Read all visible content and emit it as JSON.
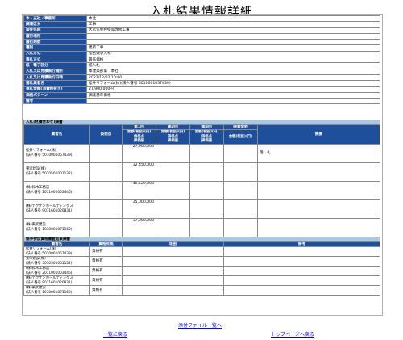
{
  "page_title": "入札結果情報詳細",
  "info_rows": [
    {
      "label": "本・支社／事務所",
      "value": "本社"
    },
    {
      "label": "調達区分",
      "value": "工事"
    },
    {
      "label": "案件名称",
      "value": "大宮信金共壁等改修工事"
    },
    {
      "label": "履行場所",
      "value": ""
    },
    {
      "label": "履行期間",
      "value": ""
    },
    {
      "label": "種別",
      "value": "建築工事"
    },
    {
      "label": "入札方式",
      "value": "指名競争入札"
    },
    {
      "label": "落札方式",
      "value": "最低価格"
    },
    {
      "label": "紙・電子区分",
      "value": "紙入札"
    },
    {
      "label": "入札又は見積執行場所",
      "value": "本建築部第　本社"
    },
    {
      "label": "入札又は見積執行日時",
      "value": "2022/12/02 10:00"
    },
    {
      "label": "落札業者名",
      "value": "松井リフォーム(株)(法人番号 5010001057439)"
    },
    {
      "label": "落札金額(消費税抜き)",
      "value": "27,900,000円"
    },
    {
      "label": "価格パターン",
      "value": "調達基準価格"
    },
    {
      "label": "備考",
      "value": ""
    }
  ],
  "bid_section": {
    "title": "入札(見積合わせ)調書",
    "headers": {
      "company": "業者名",
      "tech": "技術点",
      "round1": "第1回",
      "round2": "第2回",
      "round3": "第3回",
      "negotiation": "随意契約",
      "remarks": "摘要",
      "sub": "金額(税抜)(円)\n価格点\n評価値",
      "sub_neg": "金額(税抜)(円)"
    },
    "rows": [
      {
        "name": "松井リフォーム(株)",
        "corp": "(法人番号 5010001057439)",
        "amount": "27,900,000",
        "remark": "落　札"
      },
      {
        "name": "東栄建設(株)",
        "corp": "(法人番号 5010501001132)",
        "amount": "32,450,000",
        "remark": ""
      },
      {
        "name": "(株)鈴木工務店",
        "corp": "(法人番号 2011001003446)",
        "amount": "40,529,000",
        "remark": ""
      },
      {
        "name": "(株)テクケンホールディングス",
        "corp": "(法人番号 9011601020831)",
        "amount": "35,000,000",
        "remark": ""
      },
      {
        "name": "(株)東武建設",
        "corp": "(法人番号 1030001071160)",
        "amount": "37,000,000",
        "remark": ""
      }
    ]
  },
  "review_section": {
    "title": "競争参加資格審査結果調書",
    "headers": {
      "company": "業者名",
      "qualification": "資格有無",
      "reason": "理由",
      "remarks": "備考"
    },
    "rows": [
      {
        "name": "松井リフォーム(株)",
        "corp": "(法人番号 5010001057439)",
        "qual": "資格有"
      },
      {
        "name": "東栄建設(株)",
        "corp": "(法人番号 5010501001132)",
        "qual": "資格有"
      },
      {
        "name": "(株)鈴木工務店",
        "corp": "(法人番号 2011001003446)",
        "qual": "資格有"
      },
      {
        "name": "(株)テクケンホールディングス",
        "corp": "(法人番号 9011601020831)",
        "qual": "資格有"
      },
      {
        "name": "(株)東武建設",
        "corp": "(法人番号 1030001071160)",
        "qual": "資格有"
      }
    ]
  },
  "links": {
    "attachments": "添付ファイル一覧へ",
    "back": "一覧に戻る",
    "top": "トップページへ戻る"
  }
}
